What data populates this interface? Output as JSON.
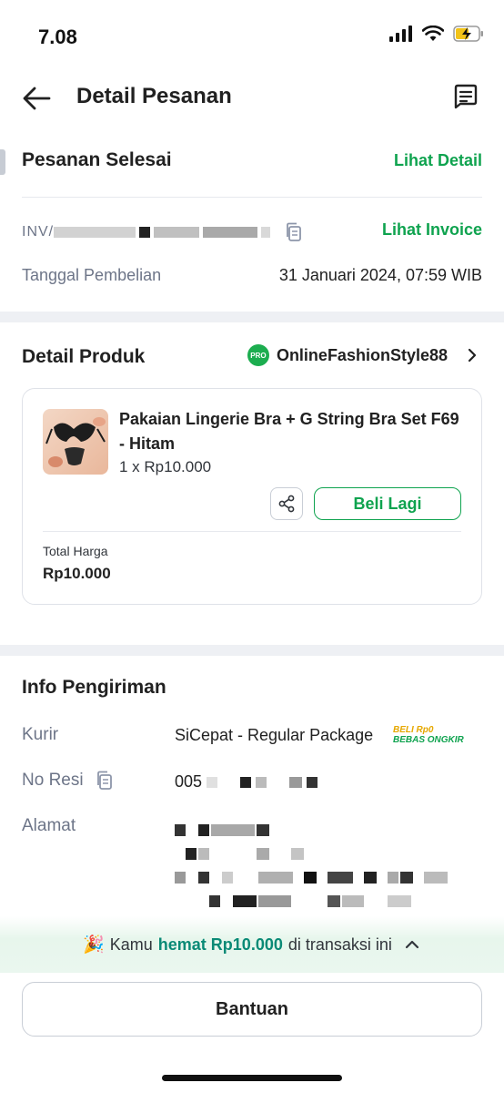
{
  "status_bar": {
    "time": "7.08"
  },
  "header": {
    "title": "Detail Pesanan"
  },
  "order": {
    "status": "Pesanan Selesai",
    "detail_link": "Lihat Detail",
    "invoice_number_prefix": "INV/",
    "invoice_link": "Lihat Invoice",
    "purchase_date_label": "Tanggal Pembelian",
    "purchase_date_value": "31 Januari 2024, 07:59 WIB"
  },
  "product_section": {
    "title": "Detail Produk",
    "shop_badge": "PRO",
    "shop_name": "OnlineFashionStyle88",
    "product": {
      "name": "Pakaian Lingerie Bra + G String Bra Set F69 - Hitam",
      "quantity_price": "1 x Rp10.000",
      "buy_again": "Beli Lagi",
      "total_label": "Total Harga",
      "total_value": "Rp10.000"
    }
  },
  "shipping": {
    "title": "Info Pengiriman",
    "courier_label": "Kurir",
    "courier_value": "SiCepat - Regular Package",
    "promo_line1": "BELI Rp0",
    "promo_line2": "BEBAS ONGKIR",
    "receipt_label": "No Resi",
    "receipt_value_prefix": "005",
    "address_label": "Alamat"
  },
  "savings": {
    "prefix": "Kamu",
    "highlight": "hemat Rp10.000",
    "suffix": "di transaksi ini"
  },
  "footer": {
    "help_button": "Bantuan"
  },
  "colors": {
    "accent_green": "#0fa34f",
    "savings_teal": "#0a8a76",
    "divider": "#eef0f4"
  }
}
